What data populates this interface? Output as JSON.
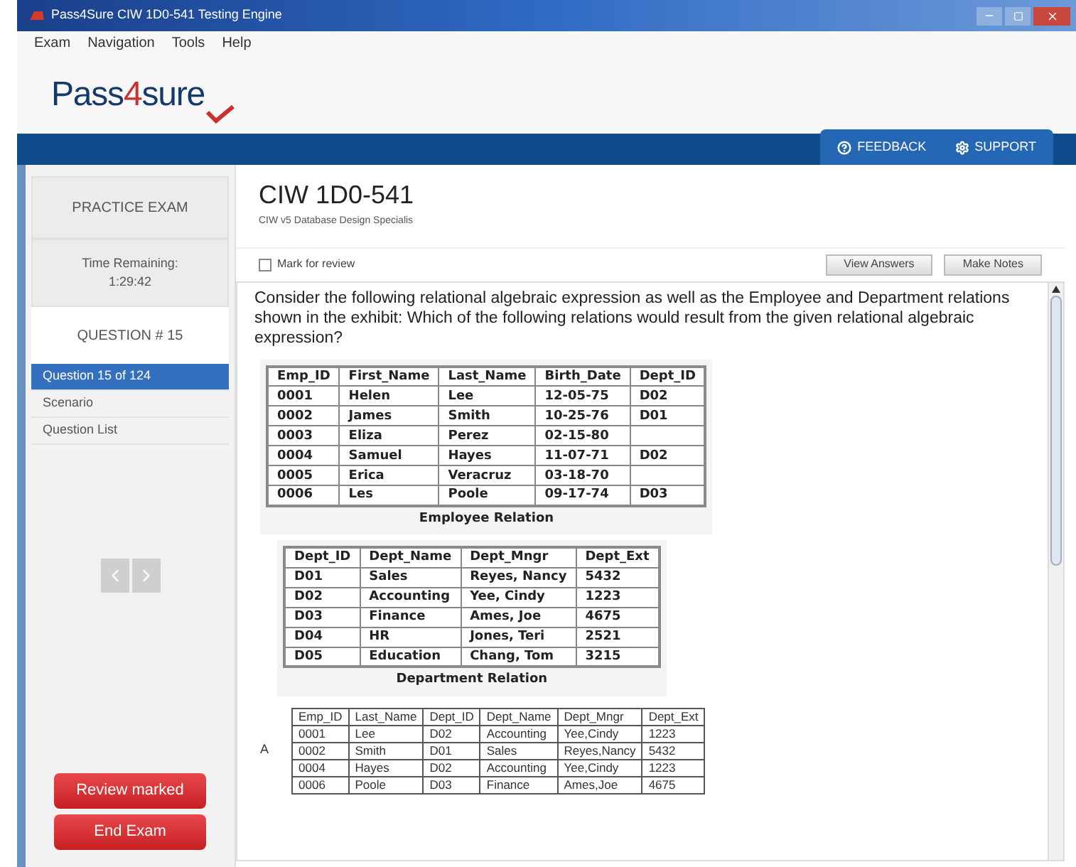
{
  "window": {
    "title": "Pass4Sure CIW 1D0-541 Testing Engine"
  },
  "menu": [
    "Exam",
    "Navigation",
    "Tools",
    "Help"
  ],
  "logo": {
    "prefix": "Pass",
    "digit": "4",
    "suffix": "sure"
  },
  "header_tabs": [
    {
      "label": "FEEDBACK"
    },
    {
      "label": "SUPPORT"
    }
  ],
  "sidebar": {
    "mode": "PRACTICE EXAM",
    "time_label": "Time Remaining:",
    "time": "1:29:42",
    "question_label": "QUESTION # 15",
    "items": [
      {
        "label": "Question 15 of 124",
        "selected": true
      },
      {
        "label": "Scenario",
        "selected": false
      },
      {
        "label": "Question List",
        "selected": false
      }
    ],
    "buttons": [
      "Review marked",
      "End Exam"
    ]
  },
  "exam": {
    "title": "CIW 1D0-541",
    "subtitle": "CIW v5 Database Design Specialis",
    "mark_for_review": {
      "label": "Mark for review",
      "checked": false
    },
    "buttons": [
      "View Answers",
      "Make Notes"
    ]
  },
  "question": "Consider the following relational algebraic expression as well as the Employee and Department relations shown in the exhibit: Which of the following relations would result from the given relational algebraic expression?",
  "exhibits": [
    {
      "caption": "Employee Relation",
      "columns": [
        "Emp_ID",
        "First_Name",
        "Last_Name",
        "Birth_Date",
        "Dept_ID"
      ],
      "rows": [
        [
          "0001",
          "Helen",
          "Lee",
          "12-05-75",
          "D02"
        ],
        [
          "0002",
          "James",
          "Smith",
          "10-25-76",
          "D01"
        ],
        [
          "0003",
          "Eliza",
          "Perez",
          "02-15-80",
          ""
        ],
        [
          "0004",
          "Samuel",
          "Hayes",
          "11-07-71",
          "D02"
        ],
        [
          "0005",
          "Erica",
          "Veracruz",
          "03-18-70",
          ""
        ],
        [
          "0006",
          "Les",
          "Poole",
          "09-17-74",
          "D03"
        ]
      ]
    },
    {
      "caption": "Department Relation",
      "columns": [
        "Dept_ID",
        "Dept_Name",
        "Dept_Mngr",
        "Dept_Ext"
      ],
      "rows": [
        [
          "D01",
          "Sales",
          "Reyes, Nancy",
          "5432"
        ],
        [
          "D02",
          "Accounting",
          "Yee, Cindy",
          "1223"
        ],
        [
          "D03",
          "Finance",
          "Ames, Joe",
          "4675"
        ],
        [
          "D04",
          "HR",
          "Jones, Teri",
          "2521"
        ],
        [
          "D05",
          "Education",
          "Chang, Tom",
          "3215"
        ]
      ]
    }
  ],
  "options": [
    {
      "letter": "A",
      "columns": [
        "Emp_ID",
        "Last_Name",
        "Dept_ID",
        "Dept_Name",
        "Dept_Mngr",
        "Dept_Ext"
      ],
      "rows": [
        [
          "0001",
          "Lee",
          "D02",
          "Accounting",
          "Yee,Cindy",
          "1223"
        ],
        [
          "0002",
          "Smith",
          "D01",
          "Sales",
          "Reyes,Nancy",
          "5432"
        ],
        [
          "0004",
          "Hayes",
          "D02",
          "Accounting",
          "Yee,Cindy",
          "1223"
        ],
        [
          "0006",
          "Poole",
          "D03",
          "Finance",
          "Ames,Joe",
          "4675"
        ]
      ]
    }
  ]
}
